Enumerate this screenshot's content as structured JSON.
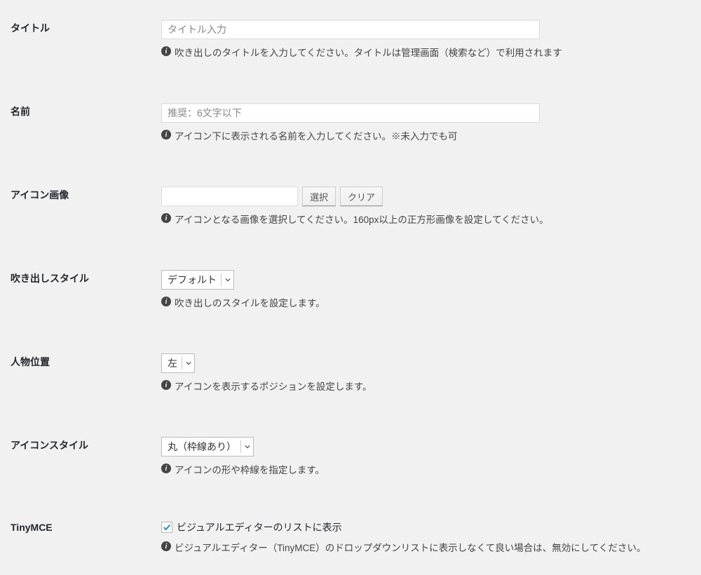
{
  "fields": {
    "title": {
      "label": "タイトル",
      "placeholder": "タイトル入力",
      "value": "",
      "help": "吹き出しのタイトルを入力してください。タイトルは管理画面（検索など）で利用されます"
    },
    "name": {
      "label": "名前",
      "placeholder": "推奨：6文字以下",
      "value": "",
      "help": "アイコン下に表示される名前を入力してください。※未入力でも可"
    },
    "icon_image": {
      "label": "アイコン画像",
      "value": "",
      "select_btn": "選択",
      "clear_btn": "クリア",
      "help": "アイコンとなる画像を選択してください。160px以上の正方形画像を設定してください。"
    },
    "balloon_style": {
      "label": "吹き出しスタイル",
      "selected": "デフォルト",
      "help": "吹き出しのスタイルを設定します。"
    },
    "position": {
      "label": "人物位置",
      "selected": "左",
      "help": "アイコンを表示するポジションを設定します。"
    },
    "icon_style": {
      "label": "アイコンスタイル",
      "selected": "丸（枠線あり）",
      "help": "アイコンの形や枠線を指定します。"
    },
    "tinymce": {
      "label": "TinyMCE",
      "checkbox_label": "ビジュアルエディターのリストに表示",
      "checked": true,
      "help": "ビジュアルエディター（TinyMCE）のドロップダウンリストに表示しなくて良い場合は、無効にしてください。"
    }
  }
}
